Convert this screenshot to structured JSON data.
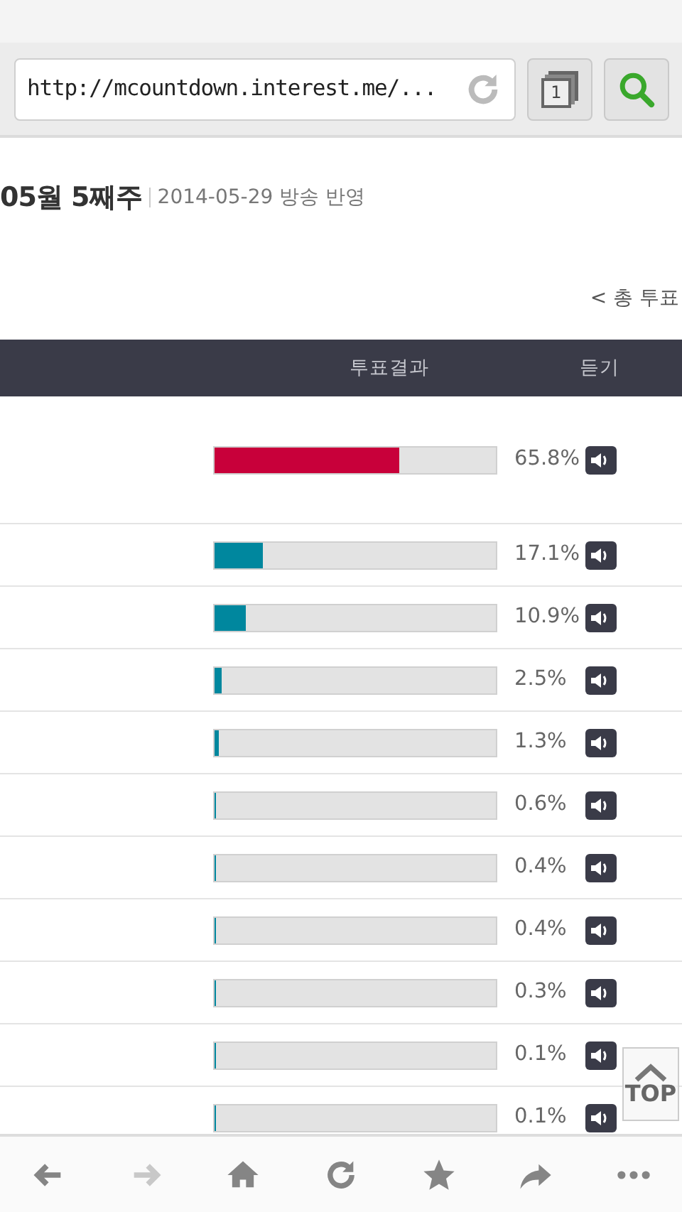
{
  "browser": {
    "url": "http://mcountdown.interest.me/...",
    "tab_count": "1"
  },
  "heading": {
    "title": "05월 5째주",
    "date": "2014-05-29 방송 반영"
  },
  "total_link": "< 총 투표",
  "table": {
    "columns": [
      "투표결과",
      "듣기"
    ],
    "rows": [
      {
        "level": 0.658,
        "reading": "65.8%",
        "leader": true
      },
      {
        "level": 0.171,
        "reading": "17.1%",
        "leader": false
      },
      {
        "level": 0.109,
        "reading": "10.9%",
        "leader": false
      },
      {
        "level": 0.025,
        "reading": "2.5%",
        "leader": false
      },
      {
        "level": 0.013,
        "reading": "1.3%",
        "leader": false
      },
      {
        "level": 0.006,
        "reading": "0.6%",
        "leader": false
      },
      {
        "level": 0.004,
        "reading": "0.4%",
        "leader": false
      },
      {
        "level": 0.004,
        "reading": "0.4%",
        "leader": false
      },
      {
        "level": 0.003,
        "reading": "0.3%",
        "leader": false
      },
      {
        "level": 0.001,
        "reading": "0.1%",
        "leader": false
      },
      {
        "level": 0.001,
        "reading": "0.1%",
        "leader": false
      }
    ]
  },
  "top_button": "TOP",
  "bottom_bar": [
    {
      "kind": "back",
      "disabled": false
    },
    {
      "kind": "forward",
      "disabled": true
    },
    {
      "kind": "home",
      "disabled": false
    },
    {
      "kind": "reload",
      "disabled": false
    },
    {
      "kind": "bookmark",
      "disabled": false
    },
    {
      "kind": "share",
      "disabled": false
    },
    {
      "kind": "more",
      "disabled": false
    }
  ]
}
